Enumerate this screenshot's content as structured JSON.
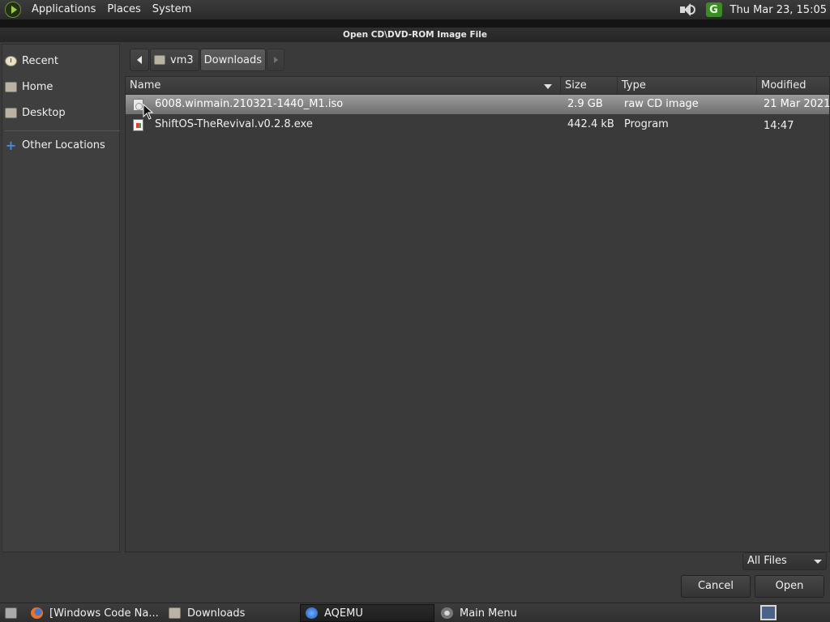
{
  "top_panel": {
    "menus": [
      "Applications",
      "Places",
      "System"
    ],
    "clock": "Thu Mar 23, 15:05",
    "update_icon_label": "G"
  },
  "dialog": {
    "title": "Open CD\\DVD-ROM Image File",
    "sidebar": [
      {
        "label": "Recent",
        "icon": "recent-icon"
      },
      {
        "label": "Home",
        "icon": "home-folder-icon"
      },
      {
        "label": "Desktop",
        "icon": "desktop-folder-icon"
      },
      {
        "label": "Other Locations",
        "icon": "plus-icon"
      }
    ],
    "path": [
      "vm3",
      "Downloads"
    ],
    "columns": {
      "name": "Name",
      "size": "Size",
      "type": "Type",
      "modified": "Modified"
    },
    "files": [
      {
        "name": "6008.winmain.210321-1440_M1.iso",
        "size": "2.9 GB",
        "type": "raw CD image",
        "modified": "21 Mar 2021",
        "icon": "disc-image-icon",
        "selected": true
      },
      {
        "name": "ShiftOS-TheRevival.v0.2.8.exe",
        "size": "442.4 kB",
        "type": "Program",
        "modified": "14:47",
        "icon": "executable-icon",
        "selected": false
      }
    ],
    "filter": "All Files",
    "cancel_label": "Cancel",
    "open_label": "Open"
  },
  "taskbar": {
    "items": [
      {
        "label": "[Windows Code Na...",
        "icon": "firefox-icon",
        "active": false
      },
      {
        "label": "Downloads",
        "icon": "folder-icon",
        "active": false
      },
      {
        "label": "AQEMU",
        "icon": "aqemu-icon",
        "active": true
      },
      {
        "label": "Main Menu",
        "icon": "main-menu-icon",
        "active": false
      }
    ]
  },
  "colors": {
    "panel": "#2e2e2e",
    "dialog_bg": "#3a3a3a",
    "selection": "#8a8a8a"
  }
}
